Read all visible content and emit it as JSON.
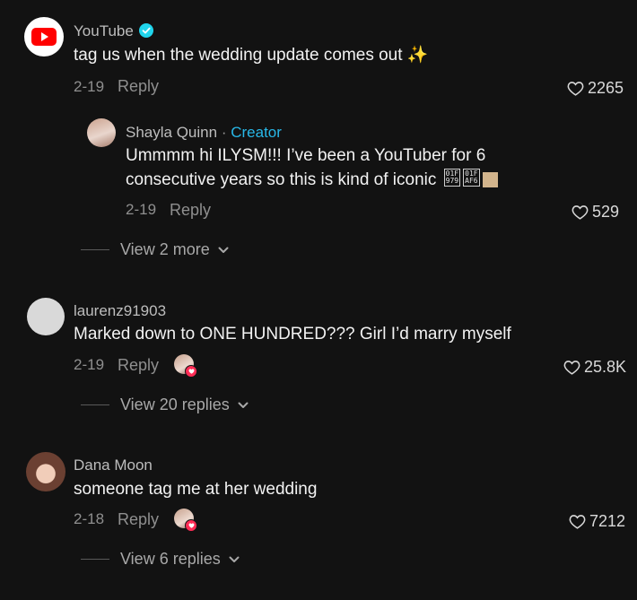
{
  "comments": [
    {
      "username": "YouTube",
      "text": "tag us when the wedding update comes out",
      "emoji": "✨",
      "date": "2-19",
      "reply_label": "Reply",
      "likes": "2265",
      "avatar_icon": "youtube-logo-icon",
      "verified": true,
      "replies": [
        {
          "username": "Shayla Quinn",
          "separator": "·",
          "badge": "Creator",
          "text_line1": "Ummmm hi ILYSM!!! I’ve been a YouTuber for 6",
          "text_line2": "consecutive years so this is kind of iconic",
          "glyph1": "01F\n979",
          "glyph2": "01F\nAF6",
          "date": "2-19",
          "reply_label": "Reply",
          "likes": "529"
        }
      ],
      "view_more": "View 2 more"
    },
    {
      "username": "laurenz91903",
      "text": "Marked down to ONE HUNDRED??? Girl I’d marry myself",
      "date": "2-19",
      "reply_label": "Reply",
      "likes": "25.8K",
      "creator_liked": true,
      "view_more": "View 20 replies"
    },
    {
      "username": "Dana Moon",
      "text": "someone tag me at her wedding",
      "date": "2-18",
      "reply_label": "Reply",
      "likes": "7212",
      "creator_liked": true,
      "view_more": "View 6 replies"
    }
  ],
  "colors": {
    "background": "#121212",
    "creator_badge": "#28b8e8",
    "verified": "#20d5ec",
    "like_heart_badge": "#fe2c55"
  }
}
